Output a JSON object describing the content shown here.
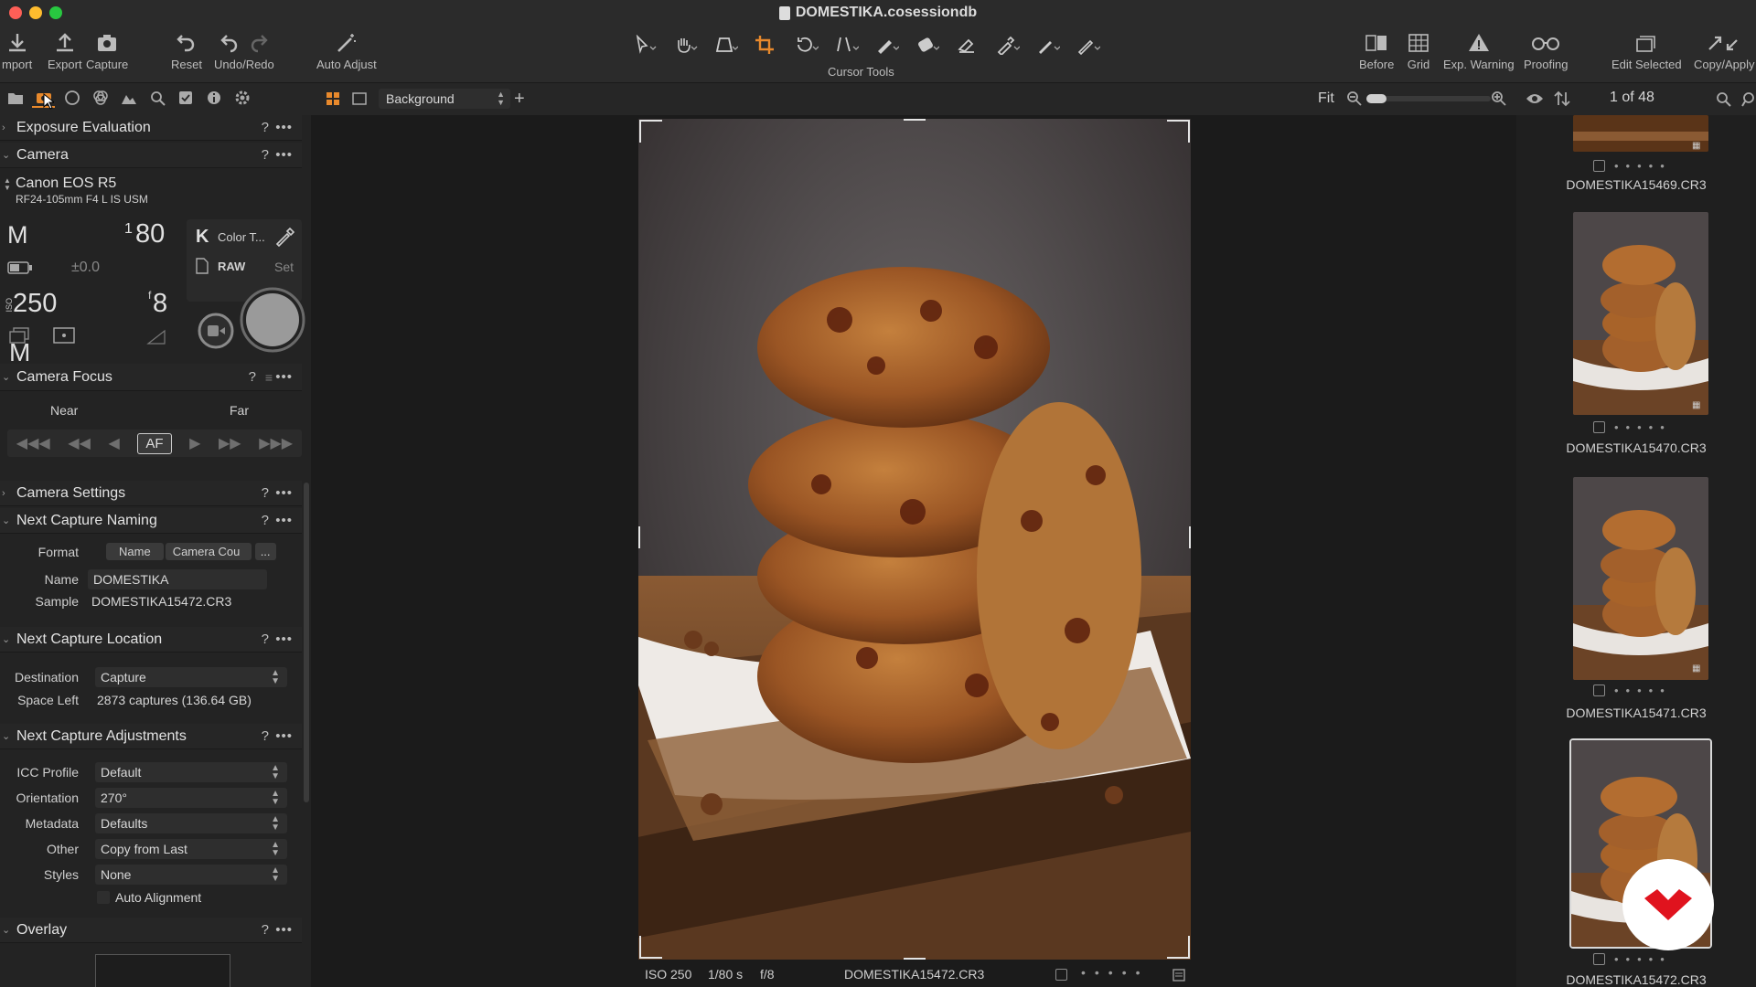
{
  "window": {
    "title": "DOMESTIKA.cosessiondb"
  },
  "toolbar": {
    "import": "mport",
    "export": "Export",
    "capture": "Capture",
    "reset": "Reset",
    "undo_redo": "Undo/Redo",
    "auto_adjust": "Auto Adjust",
    "cursor_tools": "Cursor Tools",
    "before": "Before",
    "grid": "Grid",
    "exp_warning": "Exp. Warning",
    "proofing": "Proofing",
    "edit_selected": "Edit Selected",
    "copy_apply": "Copy/Apply"
  },
  "viewer_bar": {
    "layer": "Background",
    "fit": "Fit",
    "count": "1 of 48"
  },
  "sections": {
    "exposure_evaluation": "Exposure Evaluation",
    "camera": "Camera",
    "camera_focus": "Camera Focus",
    "camera_settings": "Camera Settings",
    "next_capture_naming": "Next Capture Naming",
    "next_capture_location": "Next Capture Location",
    "next_capture_adjustments": "Next Capture Adjustments",
    "overlay": "Overlay",
    "help": "?",
    "more": "•••"
  },
  "camera": {
    "model": "Canon EOS R5",
    "lens": "RF24-105mm F4 L IS USM",
    "mode": "M",
    "shutter_num": "1",
    "shutter_den": "80",
    "ev": "±0.0",
    "iso_label": "ISO",
    "iso": "250",
    "aperture_f": "f",
    "aperture": "8",
    "wb_letter": "K",
    "wb_label": "Color T...",
    "format": "RAW",
    "set": "Set"
  },
  "focus": {
    "near": "Near",
    "far": "Far",
    "af": "AF"
  },
  "naming": {
    "format_label": "Format",
    "token1": "Name",
    "token2": "Camera Cou",
    "more": "...",
    "name_label": "Name",
    "name_value": "DOMESTIKA",
    "sample_label": "Sample",
    "sample_value": "DOMESTIKA15472.CR3"
  },
  "location": {
    "destination_label": "Destination",
    "destination_value": "Capture",
    "space_label": "Space Left",
    "space_value": "2873 captures (136.64 GB)"
  },
  "adjustments": {
    "icc_label": "ICC Profile",
    "icc_value": "Default",
    "orientation_label": "Orientation",
    "orientation_value": "270°",
    "metadata_label": "Metadata",
    "metadata_value": "Defaults",
    "other_label": "Other",
    "other_value": "Copy from Last",
    "styles_label": "Styles",
    "styles_value": "None",
    "auto_alignment": "Auto Alignment"
  },
  "status": {
    "iso": "ISO 250",
    "shutter": "1/80 s",
    "aperture": "f/8",
    "filename": "DOMESTIKA15472.CR3"
  },
  "thumbnails": [
    {
      "name": "DOMESTIKA15469.CR3"
    },
    {
      "name": "DOMESTIKA15470.CR3"
    },
    {
      "name": "DOMESTIKA15471.CR3"
    },
    {
      "name": "DOMESTIKA15472.CR3"
    }
  ],
  "colors": {
    "accent": "#e8892c",
    "brand_red": "#e0131e",
    "panel": "#232323",
    "toolbar": "#2b2b2b"
  }
}
